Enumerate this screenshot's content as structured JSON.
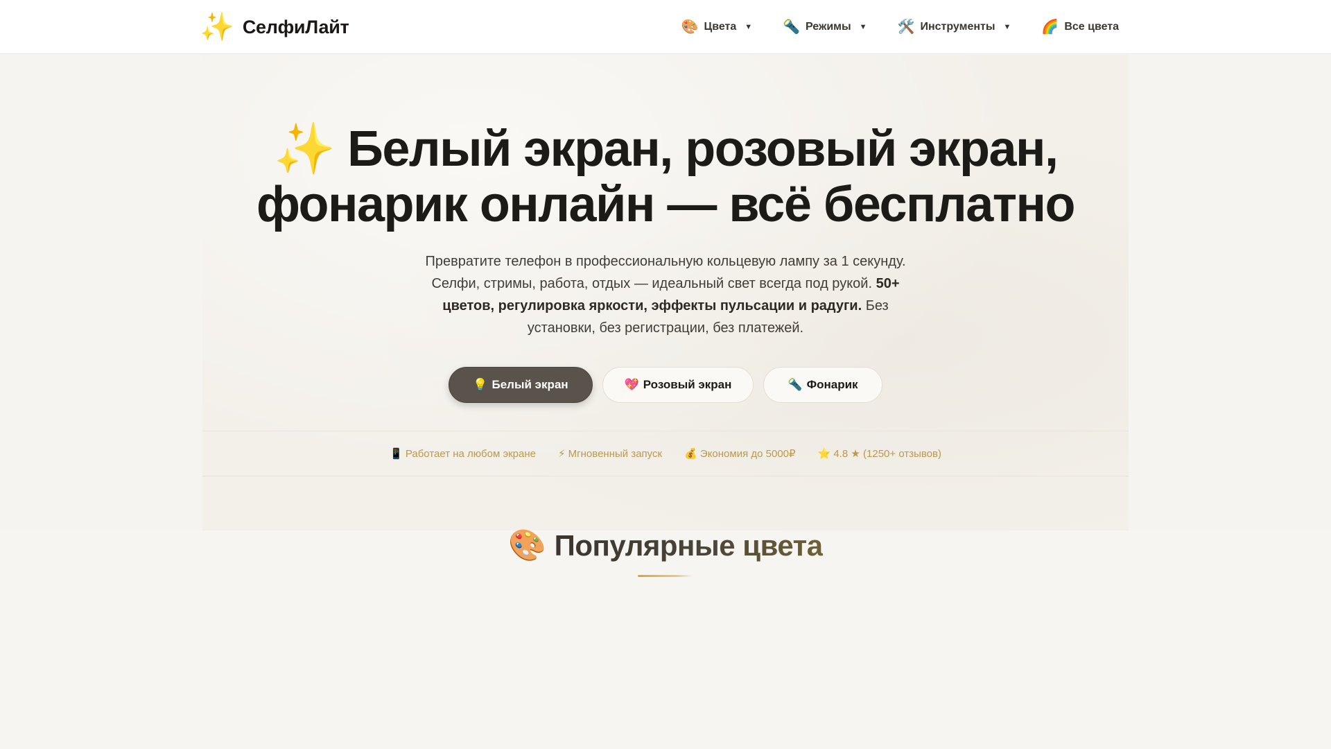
{
  "header": {
    "brand_icon": "✨",
    "brand_name": "СелфиЛайт",
    "nav": [
      {
        "icon": "🎨",
        "icon_name": "palette-icon",
        "label": "Цвета",
        "caret": "▼"
      },
      {
        "icon": "🔦",
        "icon_name": "flashlight-icon",
        "label": "Режимы",
        "caret": "▼"
      },
      {
        "icon": "🛠️",
        "icon_name": "tools-icon",
        "label": "Инструменты",
        "caret": "▼"
      },
      {
        "icon": "🌈",
        "icon_name": "rainbow-icon",
        "label": "Все цвета"
      }
    ]
  },
  "hero": {
    "title_line1": "✨ Белый экран, розовый экран,",
    "title_line2": "фонарик онлайн — всё бесплатно",
    "desc_part1": "Превратите телефон в профессиональную кольцевую лампу за 1 секунду. Селфи, стримы, работа, отдых — идеальный свет всегда под рукой. ",
    "desc_bold": "50+ цветов, регулировка яркости, эффекты пульсации и радуги.",
    "desc_part2": " Без установки, без регистрации, без платежей.",
    "buttons": [
      {
        "icon": "💡",
        "label": "Белый экран"
      },
      {
        "icon": "💖",
        "label": "Розовый экран"
      },
      {
        "icon": "🔦",
        "label": "Фонарик"
      }
    ],
    "features": [
      "📱 Работает на любом экране",
      "⚡ Мгновенный запуск",
      "💰 Экономия до 5000₽",
      "⭐ 4.8 ★ (1250+ отзывов)"
    ]
  },
  "popular": {
    "icon": "🎨",
    "title": "Популярные цвета"
  },
  "colors": {
    "primary_button": "#5a534b",
    "feature_text": "#b99a4e",
    "accent_rule": "#d4a63a"
  }
}
